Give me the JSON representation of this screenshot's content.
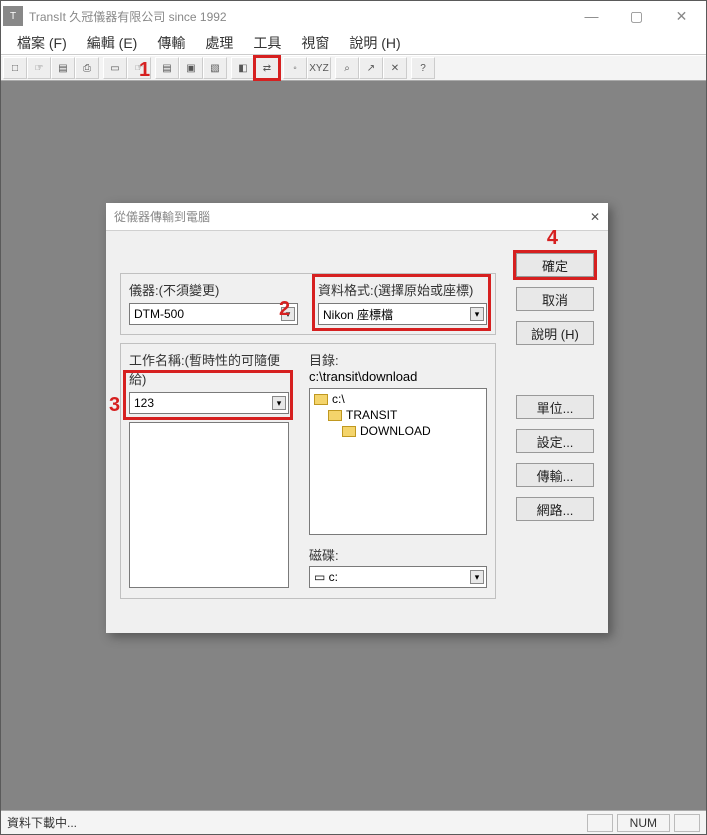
{
  "window": {
    "title": "TransIt  久冠儀器有限公司 since 1992",
    "icon_label": "T"
  },
  "menubar": [
    "檔案 (F)",
    "編輯 (E)",
    "傳輸",
    "處理",
    "工具",
    "視窗",
    "說明 (H)"
  ],
  "toolbar": {
    "buttons": [
      "□",
      "☞",
      "▤",
      "⎙",
      "",
      "▭",
      "☞",
      "",
      "▤",
      "▣",
      "▧",
      "",
      "◧",
      "⇄",
      "",
      "◦",
      "XYZ",
      "",
      "⌕",
      "↗",
      "✕",
      "",
      "?"
    ],
    "highlight_index": 13
  },
  "dialog": {
    "title": "從儀器傳輸到電腦",
    "instrument_label": "儀器:(不須變更)",
    "instrument_value": "DTM-500",
    "format_label": "資料格式:(選擇原始或座標)",
    "format_value": "Nikon 座標檔",
    "job_label": "工作名稱:(暫時性的可隨便給)",
    "job_value": "123",
    "dir_label": "目錄:",
    "dir_value": "c:\\transit\\download",
    "tree": [
      "c:\\",
      "TRANSIT",
      "DOWNLOAD"
    ],
    "disk_label": "磁碟:",
    "disk_value": "▭ c:",
    "close_x": "✕",
    "buttons": {
      "ok": "確定",
      "cancel": "取消",
      "help": "說明 (H)",
      "units": "單位...",
      "settings": "設定...",
      "transfer": "傳輸...",
      "network": "網路..."
    }
  },
  "annotations": {
    "n1": "1",
    "n2": "2",
    "n3": "3",
    "n4": "4"
  },
  "status": {
    "left": "資料下載中...",
    "num": "NUM"
  },
  "win_controls": {
    "min": "—",
    "max": "▢",
    "close": "✕"
  }
}
